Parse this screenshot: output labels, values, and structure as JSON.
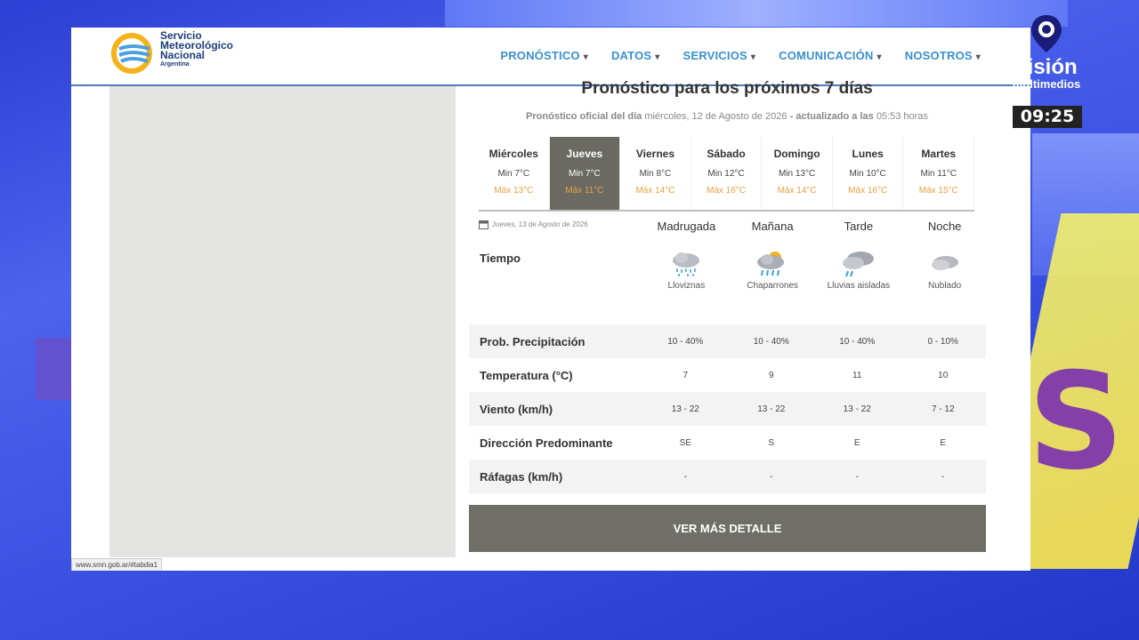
{
  "site": {
    "logo_line1": "Servicio",
    "logo_line2": "Meteorológico",
    "logo_line3": "Nacional",
    "logo_line4": "Argentina"
  },
  "nav": [
    {
      "label": "PRONÓSTICO"
    },
    {
      "label": "DATOS"
    },
    {
      "label": "SERVICIOS"
    },
    {
      "label": "COMUNICACIÓN"
    },
    {
      "label": "NOSOTROS"
    }
  ],
  "forecast": {
    "title": "Pronóstico para los próximos 7 días",
    "subtitle_prefix": "Pronóstico oficial del día",
    "subtitle_date": "miércoles, 12 de Agosto de 2026",
    "subtitle_updated": "- actualizado a las",
    "subtitle_time": "05:53 horas",
    "days": [
      {
        "name": "Miércoles",
        "min": "Min 7°C",
        "max": "Máx 13°C"
      },
      {
        "name": "Jueves",
        "min": "Min 7°C",
        "max": "Máx 11°C"
      },
      {
        "name": "Viernes",
        "min": "Min 8°C",
        "max": "Máx 14°C"
      },
      {
        "name": "Sábado",
        "min": "Min 12°C",
        "max": "Máx 16°C"
      },
      {
        "name": "Domingo",
        "min": "Min 13°C",
        "max": "Máx 14°C"
      },
      {
        "name": "Lunes",
        "min": "Min 10°C",
        "max": "Máx 16°C"
      },
      {
        "name": "Martes",
        "min": "Min 11°C",
        "max": "Máx 15°C"
      }
    ],
    "selected_date": "Jueves, 13 de Agosto de 2026",
    "periods": [
      "Madrugada",
      "Mañana",
      "Tarde",
      "Noche"
    ],
    "tiempo_label": "Tiempo",
    "conditions": [
      "Lloviznas",
      "Chaparrones",
      "Lluvias aisladas",
      "Nublado"
    ],
    "rows": [
      {
        "label": "Prob. Precipitación",
        "values": [
          "10 - 40%",
          "10 - 40%",
          "10 - 40%",
          "0 - 10%"
        ]
      },
      {
        "label": "Temperatura (°C)",
        "values": [
          "7",
          "9",
          "11",
          "10"
        ]
      },
      {
        "label": "Viento (km/h)",
        "values": [
          "13 - 22",
          "13 - 22",
          "13 - 22",
          "7 - 12"
        ]
      },
      {
        "label": "Dirección Predominante",
        "values": [
          "SE",
          "S",
          "E",
          "E"
        ]
      },
      {
        "label": "Ráfagas (km/h)",
        "values": [
          "-",
          "-",
          "-",
          "-"
        ]
      }
    ],
    "button": "VER MÁS DETALLE"
  },
  "statusbar": "www.smn.gob.ar/#tabdia1",
  "overlay": {
    "brand": "visión",
    "brand_sub": "multimedios",
    "clock": "09:25"
  },
  "colors": {
    "nav": "#3a8fd0",
    "active_day": "#6a6a62",
    "max_temp": "#e8a040",
    "button": "#6f6f68"
  }
}
